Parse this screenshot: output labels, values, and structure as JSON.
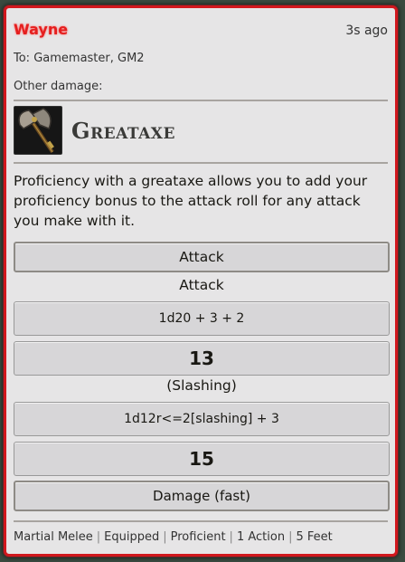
{
  "message": {
    "sender": "Wayne",
    "timestamp": "3s ago",
    "recipients": "To: Gamemaster, GM2",
    "flavor": "Other damage:"
  },
  "item": {
    "name": "Greataxe",
    "icon": "greataxe-icon",
    "description": "Proficiency with a greataxe allows you to add your proficiency bonus to the attack roll for any attack you make with it."
  },
  "attack": {
    "button_label": "Attack",
    "heading": "Attack",
    "formula": "1d20 + 3 + 2",
    "total": "13"
  },
  "damage": {
    "type_label": "(Slashing)",
    "formula": "1d12r<=2[slashing] + 3",
    "total": "15",
    "button_label": "Damage (fast)"
  },
  "properties": [
    "Martial Melee",
    "Equipped",
    "Proficient",
    "1 Action",
    "5 Feet"
  ],
  "colors": {
    "border": "#d1171d",
    "sender": "#e51f1f",
    "card_bg": "#e6e5e6"
  }
}
